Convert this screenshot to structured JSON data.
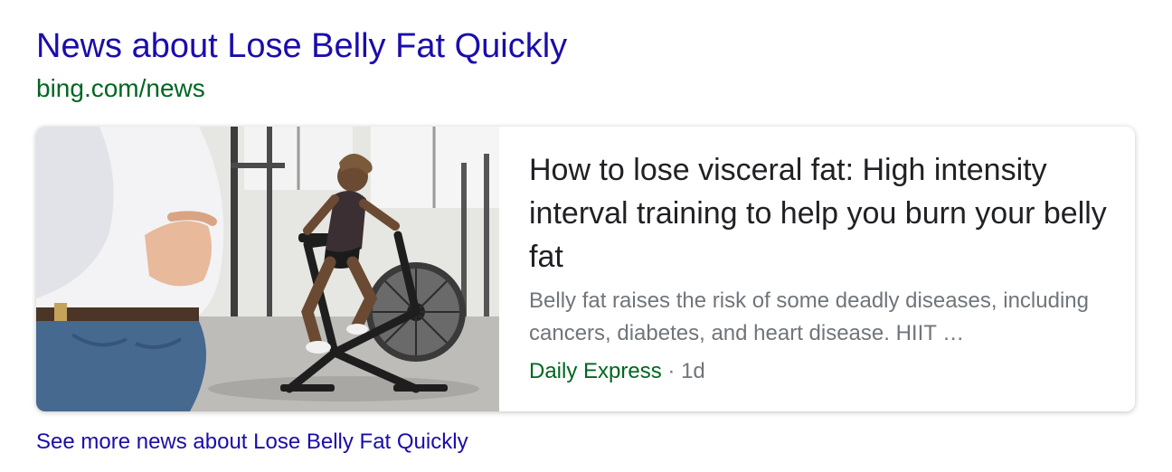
{
  "header": {
    "title": "News about Lose Belly Fat Quickly",
    "source_url": "bing.com/news"
  },
  "news_card": {
    "title": "How to lose visceral fat: High intensity interval training to help you burn your belly fat",
    "snippet": "Belly fat raises the risk of some deadly diseases, including cancers, diabetes, and heart disease. HIIT …",
    "publisher": "Daily Express",
    "separator": "·",
    "age": "1d"
  },
  "footer": {
    "more_link": "See more news about Lose Belly Fat Quickly"
  },
  "colors": {
    "link": "#1a0dab",
    "url_green": "#006621",
    "title_text": "#202124",
    "snippet_text": "#70757a"
  }
}
